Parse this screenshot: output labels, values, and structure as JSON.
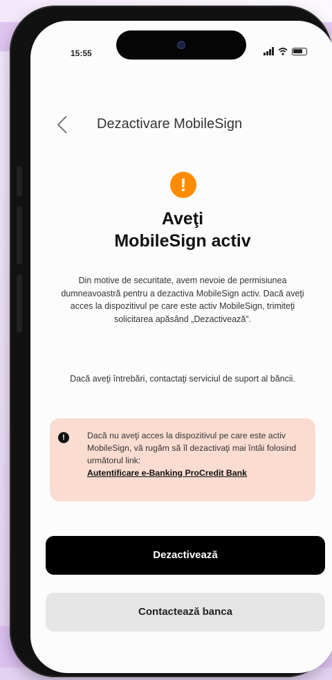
{
  "status_bar": {
    "time": "15:55"
  },
  "header": {
    "title": "Dezactivare MobileSign"
  },
  "main": {
    "heading_line1": "Aveţi",
    "heading_line2": "MobileSign activ",
    "paragraph1": "Din motive de securitate, avem nevoie de permisiunea dumneavoastră pentru a dezactiva MobileSign activ. Dacă aveţi acces la dispozitivul pe care este activ MobileSign, trimiteţi solicitarea apăsând „Dezactivează”.",
    "paragraph2": "Dacă aveţi întrebări, contactaţi serviciul de suport al băncii.",
    "alert_text": "Dacă nu aveţi acces la dispozitivul pe care este activ MobileSign, vă rugăm să îl dezactivaţi mai întâi folosind următorul link:",
    "alert_link": "Autentificare e-Banking ProCredit Bank"
  },
  "buttons": {
    "primary": "Dezactivează",
    "secondary": "Contactează banca"
  },
  "colors": {
    "warning": "#ff8c00",
    "alert_bg": "#fbdcd0",
    "primary_bg": "#000000"
  },
  "icons": {
    "back": "chevron-left-icon",
    "warning": "exclamation-circle-icon",
    "alert": "info-exclamation-icon"
  }
}
